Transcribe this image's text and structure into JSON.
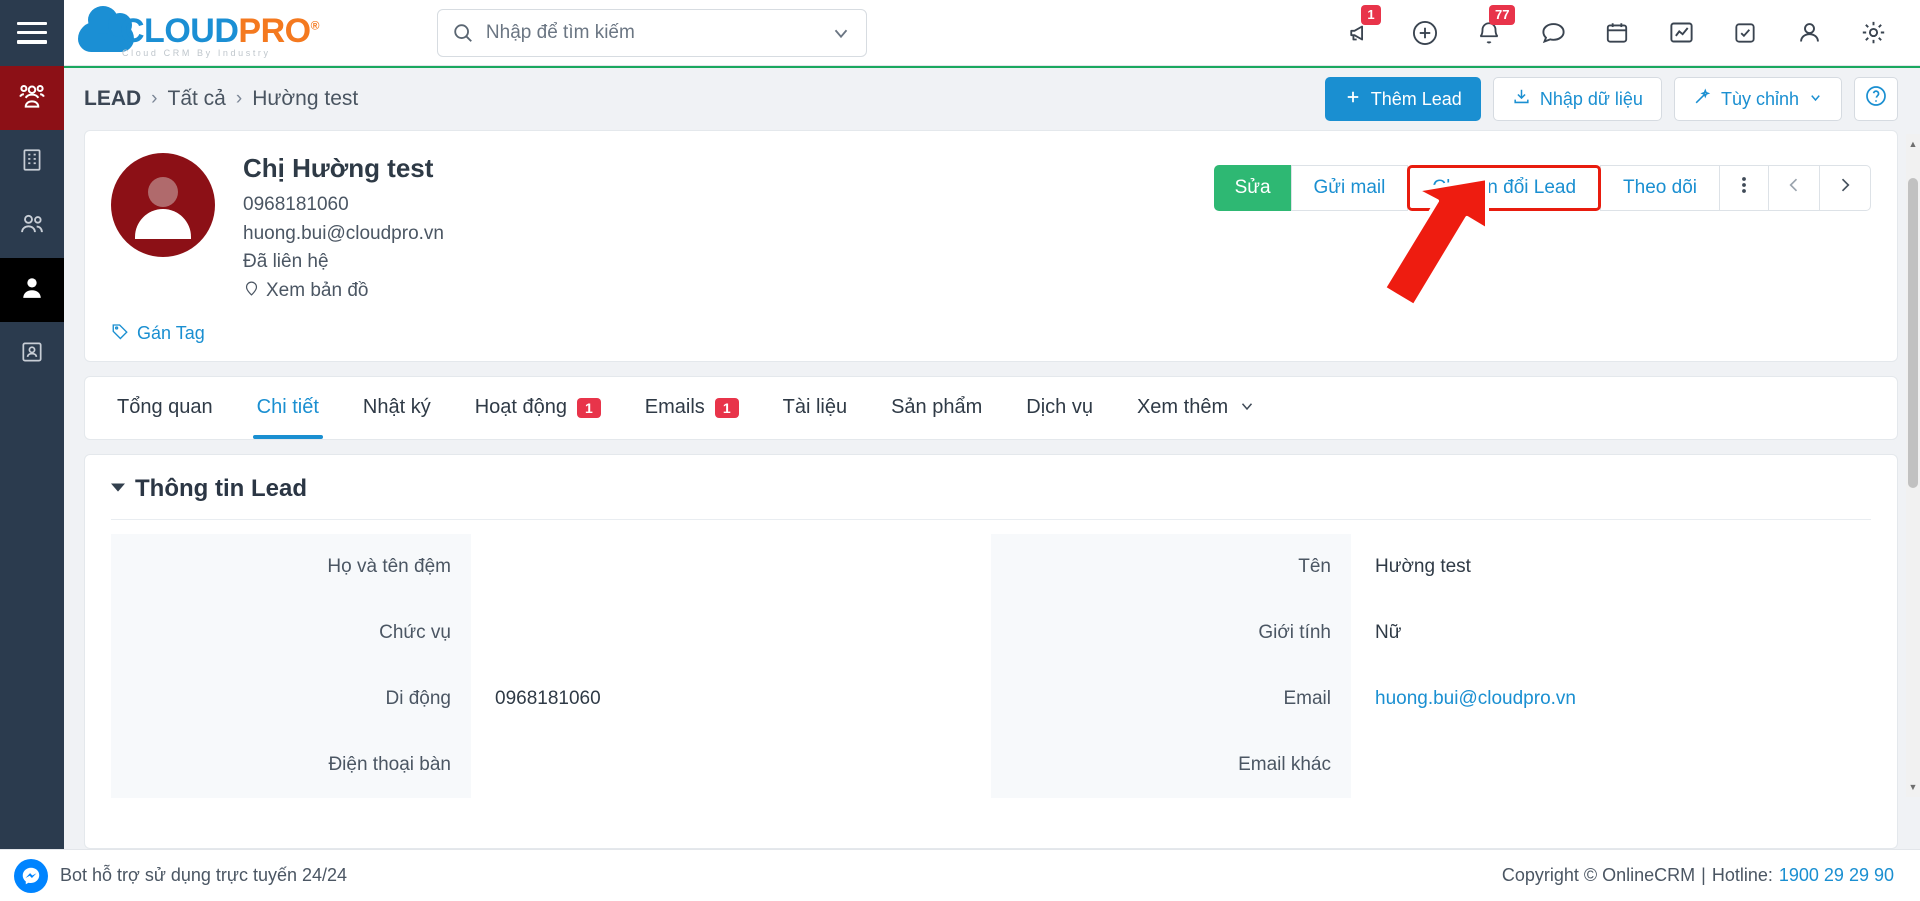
{
  "brand": {
    "logo_main_1": "CLOUD",
    "logo_main_2": "PRO",
    "logo_reg": "®",
    "logo_sub": "Cloud CRM By Industry",
    "accent_blue": "#1a8fd1",
    "accent_orange": "#f4791f",
    "accent_green": "#2eb873",
    "badge_red": "#e8344a",
    "sidebar_dark": "#2b3b4e",
    "lead_red": "#8c1016",
    "highlight_red": "#e81c0e"
  },
  "search": {
    "placeholder": "Nhập để tìm kiếm",
    "value": "",
    "icon": "search-icon",
    "caret_icon": "chevron-down-icon"
  },
  "top_icons": [
    {
      "name": "megaphone-icon",
      "badge": "1"
    },
    {
      "name": "plus-circle-icon",
      "badge": ""
    },
    {
      "name": "bell-icon",
      "badge": "77"
    },
    {
      "name": "chat-bubble-icon",
      "badge": ""
    },
    {
      "name": "calendar-icon",
      "badge": ""
    },
    {
      "name": "chart-icon",
      "badge": ""
    },
    {
      "name": "checklist-icon",
      "badge": ""
    },
    {
      "name": "user-icon",
      "badge": ""
    },
    {
      "name": "gear-icon",
      "badge": ""
    }
  ],
  "sidebar": {
    "items": [
      {
        "name": "sidebar-item-customers",
        "icon": "people-group-icon",
        "state": "lead"
      },
      {
        "name": "sidebar-item-company",
        "icon": "building-icon",
        "state": ""
      },
      {
        "name": "sidebar-item-contacts",
        "icon": "two-people-icon",
        "state": ""
      },
      {
        "name": "sidebar-item-lead",
        "icon": "person-icon",
        "state": "active"
      },
      {
        "name": "sidebar-item-documents",
        "icon": "id-card-icon",
        "state": ""
      }
    ]
  },
  "breadcrumb": {
    "root": "LEAD",
    "sep": "›",
    "level2": "Tất cả",
    "level3": "Hường test"
  },
  "page_actions": {
    "add_lead": "Thêm Lead",
    "add_lead_icon": "plus-icon",
    "import": "Nhập dữ liệu",
    "import_icon": "download-icon",
    "customize": "Tùy chỉnh",
    "customize_icon": "wand-icon",
    "customize_caret": "chevron-down-icon",
    "help": "?",
    "help_icon": "question-circle-icon"
  },
  "profile": {
    "name": "Chị Hường test",
    "phone": "0968181060",
    "email": "huong.bui@cloudpro.vn",
    "status": "Đã liên hệ",
    "map_label": "Xem bản đồ",
    "map_icon": "map-pin-icon",
    "avatar_icon": "avatar-placeholder-icon",
    "tag_label": "Gán Tag",
    "tag_icon": "tag-icon",
    "actions": {
      "edit": "Sửa",
      "send_mail": "Gửi mail",
      "convert_lead": "Chuyển đổi Lead",
      "follow": "Theo dõi",
      "more_icon": "kebab-menu-icon",
      "prev_icon": "chevron-left-icon",
      "next_icon": "chevron-right-icon"
    }
  },
  "tabs": [
    {
      "label": "Tổng quan",
      "badge": "",
      "active": false
    },
    {
      "label": "Chi tiết",
      "badge": "",
      "active": true
    },
    {
      "label": "Nhật ký",
      "badge": "",
      "active": false
    },
    {
      "label": "Hoạt động",
      "badge": "1",
      "active": false
    },
    {
      "label": "Emails",
      "badge": "1",
      "active": false
    },
    {
      "label": "Tài liệu",
      "badge": "",
      "active": false
    },
    {
      "label": "Sản phẩm",
      "badge": "",
      "active": false
    },
    {
      "label": "Dịch vụ",
      "badge": "",
      "active": false
    },
    {
      "label": "Xem thêm",
      "badge": "",
      "active": false,
      "caret": "⌄"
    }
  ],
  "section": {
    "title": "Thông tin Lead",
    "caret_icon": "caret-down-icon"
  },
  "form": {
    "left": [
      {
        "label": "Họ và tên đệm",
        "value": "",
        "is_link": false
      },
      {
        "label": "Chức vụ",
        "value": "",
        "is_link": false
      },
      {
        "label": "Di động",
        "value": "0968181060",
        "is_link": false
      },
      {
        "label": "Điện thoại bàn",
        "value": "",
        "is_link": false
      }
    ],
    "right": [
      {
        "label": "Tên",
        "value": "Hường test",
        "is_link": false
      },
      {
        "label": "Giới tính",
        "value": "Nữ",
        "is_link": false
      },
      {
        "label": "Email",
        "value": "huong.bui@cloudpro.vn",
        "is_link": true
      },
      {
        "label": "Email khác",
        "value": "",
        "is_link": false
      }
    ]
  },
  "footer": {
    "bot_text": "Bot hỗ trợ sử dụng trực tuyến 24/24",
    "bot_icon": "messenger-icon",
    "copyright": "Copyright © OnlineCRM",
    "separator": "|",
    "hotline_label": "Hotline:",
    "hotline_number": "1900 29 29 90"
  }
}
